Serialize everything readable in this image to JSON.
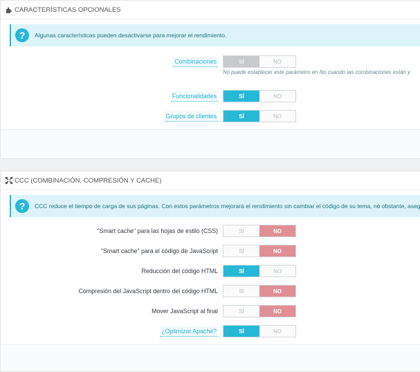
{
  "optional_features": {
    "title": "CARACTERÍSTICAS OPCIONALES",
    "info": "Algunas características pueden desactivarse para mejorar el rendimiento.",
    "rows": [
      {
        "label": "Combinaciones",
        "yes": "SÍ",
        "no": "NO",
        "state": "yes-disabled",
        "note": "No puede establecer este parámetro en No cuando las combinaciones están y"
      },
      {
        "label": "Funcionalidades",
        "yes": "SÍ",
        "no": "NO",
        "state": "yes"
      },
      {
        "label": "Grupos de clientes",
        "yes": "SÍ",
        "no": "NO",
        "state": "yes"
      }
    ]
  },
  "ccc": {
    "title": "CCC (COMBINACIÓN, COMPRESIÓN Y CACHE)",
    "info": "CCC reduce el tiempo de carga de sus páginas. Con estos parámetros mejorará el rendimiento sin cambiar el código de su tema, no obstante, asegúrese",
    "rows": [
      {
        "label": "\"Smart cache\" para las hojas de estilo (CSS)",
        "yes": "SÍ",
        "no": "NO",
        "state": "no"
      },
      {
        "label": "\"Smart cache\" para el código de JavaScript",
        "yes": "SÍ",
        "no": "NO",
        "state": "no"
      },
      {
        "label": "Reducción del código HTML",
        "yes": "SÍ",
        "no": "NO",
        "state": "yes"
      },
      {
        "label": "Compresión del JavaScript dentro del código HTML",
        "yes": "SÍ",
        "no": "NO",
        "state": "no"
      },
      {
        "label": "Mover JavaScript al final",
        "yes": "SÍ",
        "no": "NO",
        "state": "no"
      },
      {
        "label": "¿Optimizar Apache?",
        "yes": "SÍ",
        "no": "NO",
        "state": "yes"
      }
    ]
  },
  "colors": {
    "accent": "#25b9d7",
    "no_active": "#e08f95",
    "info_bg": "#dcf4f9"
  }
}
